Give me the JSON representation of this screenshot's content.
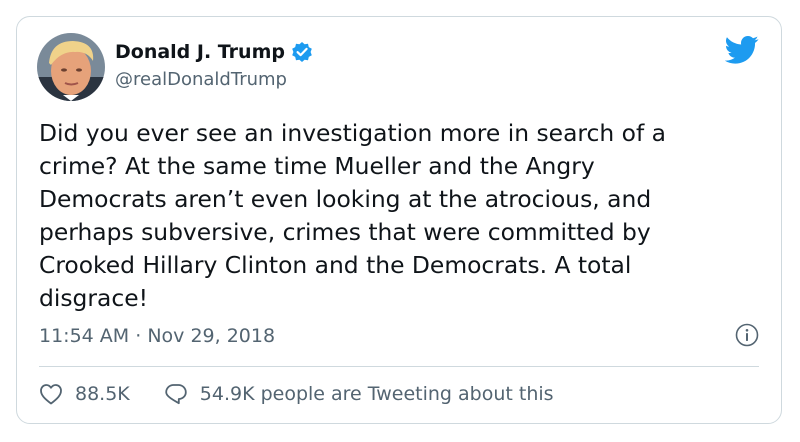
{
  "author": {
    "display_name": "Donald J. Trump",
    "handle": "@realDonaldTrump",
    "verified": true
  },
  "tweet": {
    "text_lines": [
      "Did you ever see an investigation more in search of a",
      "crime? At the same time Mueller and the Angry",
      "Democrats aren’t even looking at the atrocious, and",
      "perhaps subversive, crimes that were committed by",
      "Crooked Hillary Clinton and the Democrats. A total",
      "disgrace!"
    ],
    "time": "11:54 AM",
    "separator": "·",
    "date": "Nov 29, 2018"
  },
  "actions": {
    "likes": "88.5K",
    "tweeting": "54.9K people are Tweeting about this"
  },
  "icons": {
    "brand": "twitter-bird-icon",
    "verified": "verified-badge-icon",
    "info": "info-icon",
    "like": "heart-icon",
    "reply": "speech-bubble-icon"
  },
  "colors": {
    "brand_blue": "#1d9bf0",
    "text": "#0f1419",
    "muted": "#536471",
    "border": "#cfd9de"
  }
}
